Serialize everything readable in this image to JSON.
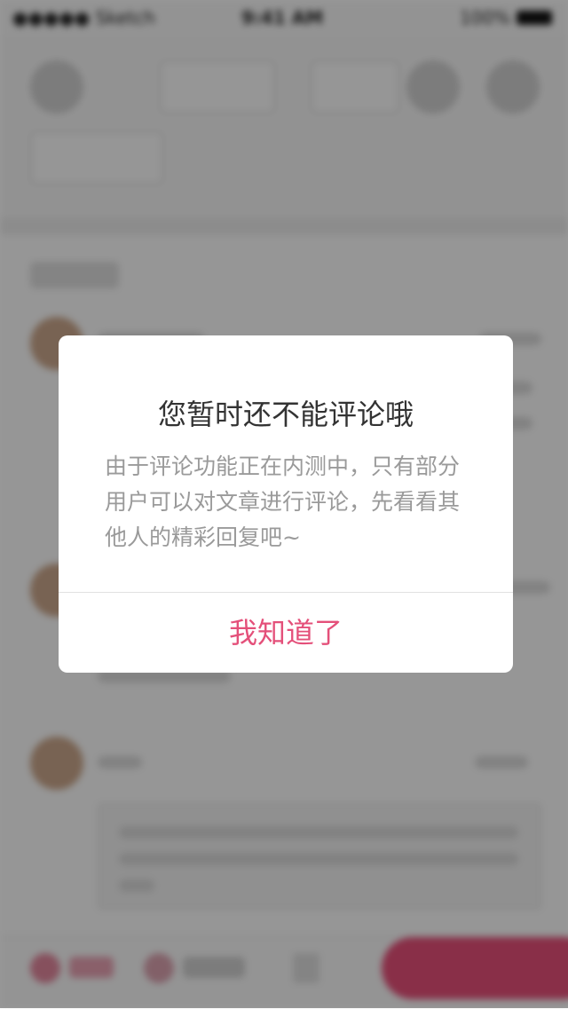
{
  "status_bar": {
    "carrier": "●●●●● Sketch",
    "time": "9:41 AM",
    "battery": "100%"
  },
  "dialog": {
    "title": "您暂时还不能评论哦",
    "message": "由于评论功能正在内测中，只有部分用户可以对文章进行评论，先看看其他人的精彩回复吧~",
    "confirm_label": "我知道了"
  },
  "colors": {
    "accent": "#e4507a",
    "title_text": "#333333",
    "body_text": "#9a9a9a"
  }
}
